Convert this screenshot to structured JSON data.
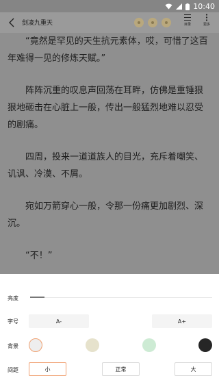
{
  "status": {
    "time": "10:40"
  },
  "topbar": {
    "title": "剑凌九重天",
    "catalog_label": "目录",
    "more_label": "更多"
  },
  "content": {
    "paragraphs": [
      "“竟然是罕见的天生抗元素体，哎，可惜了这百年难得一见的修炼天赋。”",
      "阵阵沉重的叹息声回荡在耳畔，仿佛是重锤狠狠地砸击在心脏上一般，传出一般猛烈地难以忍受的剧痛。",
      "四周，投来一道道族人的目光，充斥着嘲笑、讥讽、冷漠、不屑。",
      "宛如万箭穿心一般，令那一份痛更加剧烈、深沉。",
      "“不！”"
    ]
  },
  "settings": {
    "brightness_label": "亮度",
    "brightness_level": 0.08,
    "font_label": "字号",
    "font_decrease": "A-",
    "font_increase": "A+",
    "background_label": "背景",
    "background_colors": [
      "#eeeeee",
      "#e6e2cc",
      "#cdebd4",
      "#262626"
    ],
    "background_selected": 0,
    "spacing_label": "间距",
    "spacing_options": [
      "小",
      "正常",
      "大"
    ],
    "spacing_selected": 0
  },
  "colors": {
    "accent": "#f0a070",
    "dim_overlay": "#8f8f8f"
  }
}
